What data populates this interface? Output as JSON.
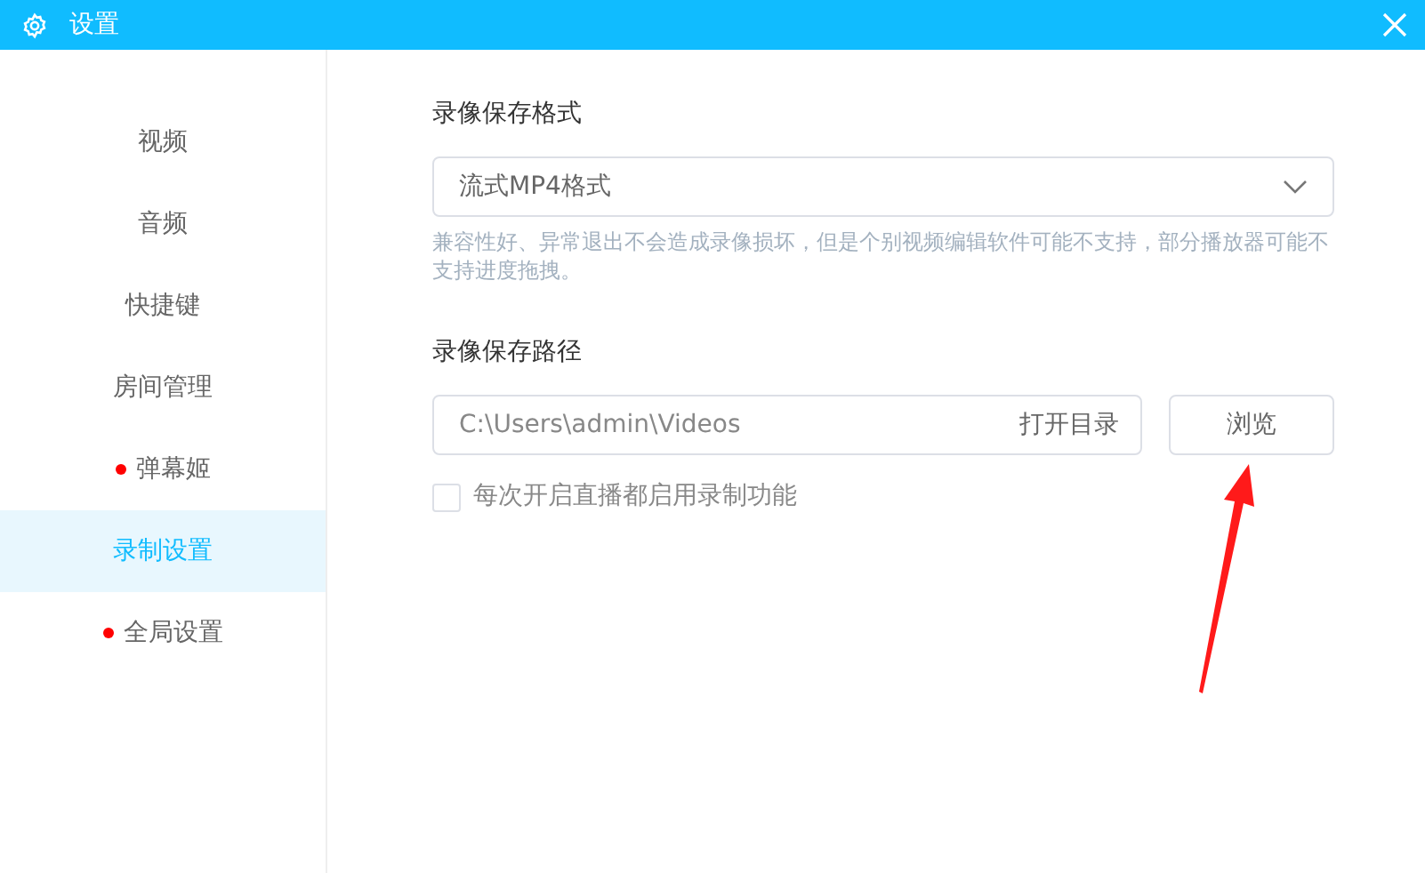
{
  "window": {
    "title": "设置"
  },
  "sidebar": {
    "items": [
      {
        "label": "视频",
        "selected": false,
        "badge": false
      },
      {
        "label": "音频",
        "selected": false,
        "badge": false
      },
      {
        "label": "快捷键",
        "selected": false,
        "badge": false
      },
      {
        "label": "房间管理",
        "selected": false,
        "badge": false
      },
      {
        "label": "弹幕姬",
        "selected": false,
        "badge": true
      },
      {
        "label": "录制设置",
        "selected": true,
        "badge": false
      },
      {
        "label": "全局设置",
        "selected": false,
        "badge": true
      }
    ]
  },
  "format": {
    "label": "录像保存格式",
    "value": "流式MP4格式",
    "hint": "兼容性好、异常退出不会造成录像损坏，但是个别视频编辑软件可能不支持，部分播放器可能不支持进度拖拽。"
  },
  "path": {
    "label": "录像保存路径",
    "value": "C:\\Users\\admin\\Videos",
    "open_link": "打开目录",
    "browse_button": "浏览"
  },
  "auto_record": {
    "label": "每次开启直播都启用录制功能",
    "checked": false
  }
}
